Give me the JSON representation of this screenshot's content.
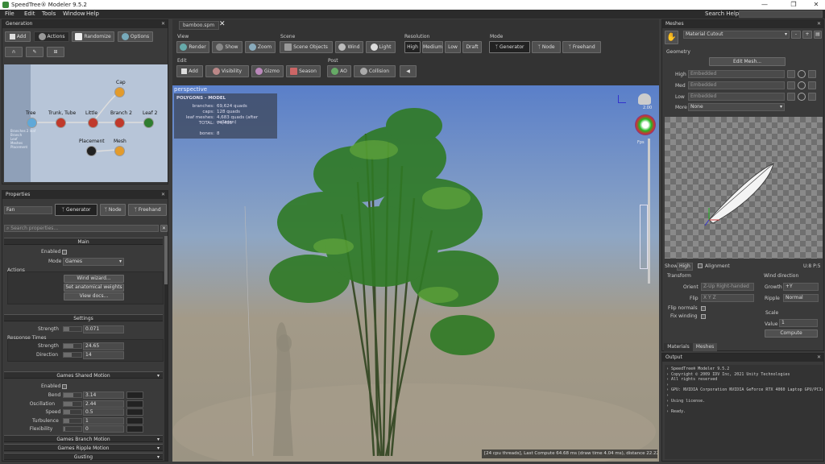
{
  "window": {
    "title": "SpeedTree® Modeler 9.5.2",
    "controls": [
      "—",
      "❐",
      "✕"
    ]
  },
  "menu": [
    "File",
    "Edit",
    "Tools",
    "Window",
    "Help"
  ],
  "search_help": {
    "label": "Search Help:",
    "value": ""
  },
  "generation": {
    "title": "Generation",
    "buttons": {
      "add": "Add",
      "actions": "Actions",
      "randomize": "Randomize",
      "options": "Options"
    },
    "nodes": [
      {
        "label": "Tree"
      },
      {
        "label": "Trunk, Tube"
      },
      {
        "label": "Little"
      },
      {
        "label": "Branch 2"
      },
      {
        "label": "Leaf 2"
      },
      {
        "label": "Cap"
      },
      {
        "label": "Placement"
      },
      {
        "label": "Mesh"
      }
    ],
    "mini_labels": [
      "Branches 2 leaf",
      "Branch",
      "Leaf",
      "Meshes",
      "Placement",
      "Seed"
    ]
  },
  "properties": {
    "title": "Properties",
    "name_value": "Fan",
    "tabs": [
      "Generator",
      "Node",
      "Freehand"
    ],
    "search_placeholder": "Search properties...",
    "main": {
      "title": "Main",
      "enabled_label": "Enabled",
      "mode_label": "Mode",
      "mode_value": "Games",
      "actions_label": "Actions",
      "action_buttons": [
        "Wind wizard...",
        "Set anatomical weights",
        "View docs..."
      ]
    },
    "settings": {
      "title": "Settings",
      "strength_label": "Strength",
      "strength_value": "0.071",
      "strength_fraction": 0.3,
      "response_label": "Response Times",
      "resp_strength_label": "Strength",
      "resp_strength_value": "24.65",
      "resp_strength_fraction": 0.55,
      "direction_label": "Direction",
      "direction_value": "14",
      "direction_fraction": 0.45
    },
    "shared": {
      "title": "Games Shared Motion",
      "enabled_label": "Enabled",
      "rows": [
        {
          "label": "Bend",
          "value": "3.14",
          "fraction": 0.55
        },
        {
          "label": "Oscillation",
          "value": "2.44",
          "fraction": 0.5
        },
        {
          "label": "Speed",
          "value": "0.5",
          "fraction": 0.35
        },
        {
          "label": "Turbulence",
          "value": "1",
          "fraction": 0.3
        },
        {
          "label": "Flexibility",
          "value": "0",
          "fraction": 0.1
        }
      ]
    },
    "collapsed": [
      "Games Branch Motion",
      "Games Ripple Motion",
      "Gusting"
    ]
  },
  "viewport": {
    "tab": "bamboo.spm",
    "sections": {
      "view": "View",
      "scene": "Scene",
      "resolution": "Resolution",
      "mode": "Mode",
      "edit": "Edit",
      "post": "Post"
    },
    "view_buttons": [
      "Render",
      "Show",
      "Zoom"
    ],
    "scene_buttons": [
      "Scene Objects",
      "Wind",
      "Light"
    ],
    "resolution_buttons": [
      "High",
      "Medium",
      "Low",
      "Draft"
    ],
    "mode_buttons": [
      "Generator",
      "Node",
      "Freehand"
    ],
    "edit_buttons": [
      "Add",
      "Visibility",
      "Gizmo",
      "Season"
    ],
    "post_buttons": [
      "AO",
      "Collision"
    ],
    "camera": "perspective",
    "stats": {
      "title": "POLYGONS - MODEL",
      "rows": [
        {
          "k": "branches:",
          "v": "69,624 quads"
        },
        {
          "k": "caps:",
          "v": "128 quads"
        },
        {
          "k": "leaf meshes:",
          "v": "4,683 quads (after collision)"
        },
        {
          "k": "TOTAL:",
          "v": "74,435"
        },
        {
          "k": "bones:",
          "v": "8"
        }
      ]
    },
    "zoom": "2.00",
    "fps_label": "Fps",
    "status": "[24 cpu threads], Last Compute 64.68 ms (draw time 4.04 ms), distance 22.22"
  },
  "meshes": {
    "title": "Meshes",
    "material": "Material Cutout",
    "geometry_label": "Geometry",
    "edit_mesh": "Edit Mesh...",
    "lods": [
      {
        "label": "High",
        "value": "Embedded"
      },
      {
        "label": "Med",
        "value": "Embedded"
      },
      {
        "label": "Low",
        "value": "Embedded"
      }
    ],
    "more_label": "More",
    "more_value": "None",
    "show_label": "Show",
    "show_value": "High",
    "alignment_label": "Alignment",
    "uv_label": "U:8 P:5",
    "transform": {
      "title": "Transform",
      "orient_label": "Orient",
      "orient_value": "Z-Up Right-handed",
      "flip_label": "Flip",
      "flip_value": "X Y Z",
      "flip_normals": "Flip normals",
      "fix_winding": "Fix winding"
    },
    "wind": {
      "title": "Wind direction",
      "growth_label": "Growth",
      "growth_value": "+Y",
      "ripple_label": "Ripple",
      "ripple_value": "Normal"
    },
    "scale": {
      "title": "Scale",
      "value_label": "Value",
      "value": "1",
      "compute": "Compute"
    },
    "tabs": [
      "Materials",
      "Meshes"
    ]
  },
  "output": {
    "title": "Output",
    "lines": [
      "SpeedTree® Modeler 9.5.2",
      "Copyright © 2009 IDV Inc, 2021 Unity Technologies",
      "All rights reserved",
      "",
      "GPU: NVIDIA Corporation NVIDIA GeForce RTX 4060 Laptop GPU/PCIe/SSE2",
      "",
      "Using license.",
      "",
      "Ready."
    ]
  }
}
